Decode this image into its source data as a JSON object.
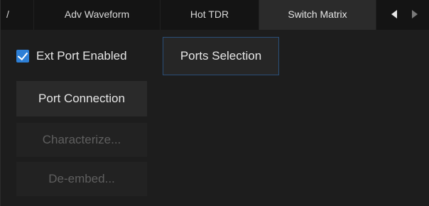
{
  "tabs": {
    "cut_label": "/",
    "adv_waveform": "Adv Waveform",
    "hot_tdr": "Hot TDR",
    "switch_matrix": "Switch Matrix",
    "active": "Switch Matrix",
    "nav_prev_icon": "triangle-left-icon",
    "nav_next_icon": "triangle-right-icon"
  },
  "switch_matrix": {
    "ext_port_enabled": {
      "label": "Ext Port Enabled",
      "checked": true,
      "check_color": "#2d7fd6"
    },
    "ports_selection_label": "Ports Selection",
    "port_connection_label": "Port Connection",
    "characterize_label": "Characterize...",
    "characterize_enabled": false,
    "deembed_label": "De-embed...",
    "deembed_enabled": false
  },
  "colors": {
    "background": "#1d1d1d",
    "accent": "#2d7fd6",
    "text": "#e6e6e6",
    "disabled_text": "#5f5f5f"
  }
}
